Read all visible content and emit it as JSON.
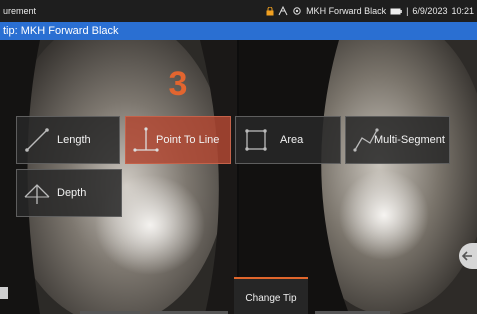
{
  "status_bar": {
    "mode": "urement",
    "tip_name": "MKH Forward Black",
    "date": "6/9/2023",
    "time": "10:21"
  },
  "tip_bar": {
    "label": "tip: MKH Forward Black"
  },
  "step_number": "3",
  "tools": [
    {
      "label": "Length",
      "icon": "length-icon"
    },
    {
      "label": "Point To Line",
      "icon": "point-to-line-icon",
      "selected": true
    },
    {
      "label": "Area",
      "icon": "area-icon"
    },
    {
      "label": "Multi-Segment",
      "icon": "multi-segment-icon"
    },
    {
      "label": "Depth",
      "icon": "depth-icon"
    }
  ],
  "change_tip": {
    "label": "Change Tip"
  },
  "colors": {
    "accent": "#e2652f",
    "tip_bar": "#2a6fd2",
    "selected": "#b04832"
  }
}
